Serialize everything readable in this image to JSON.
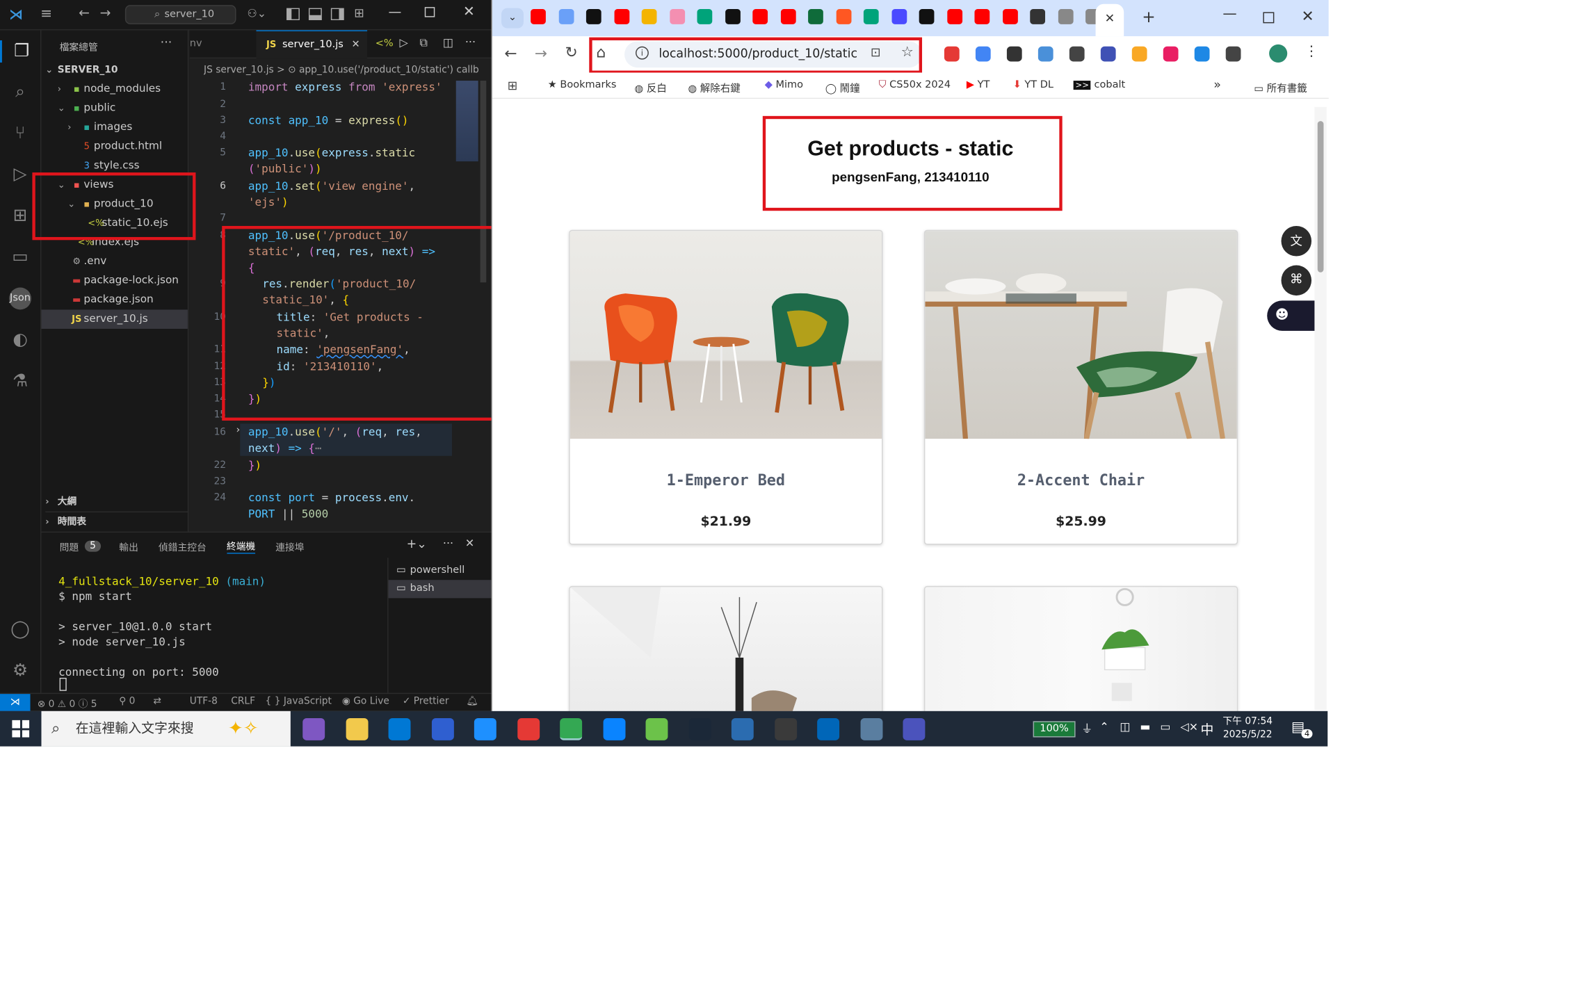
{
  "vscode": {
    "explorer_title": "檔案總管",
    "project": "SERVER_10",
    "search_label": "server_10",
    "tab_prev": "nv",
    "tab_active": "server_10.js",
    "breadcrumb": "JS server_10.js > ⊙ app_10.use('/product_10/static') callb",
    "tree": [
      "node_modules",
      "public",
      "images",
      "product.html",
      "style.css",
      "views",
      "product_10",
      "static_10.ejs",
      "index.ejs",
      ".env",
      "package-lock.json",
      "package.json",
      "server_10.js"
    ],
    "outline": "大綱",
    "timeline": "時間表",
    "line_numbers": [
      "1",
      "2",
      "3",
      "4",
      "5",
      "",
      "6",
      "",
      "7",
      "8",
      "",
      "9",
      "",
      "10",
      "",
      "11",
      "12",
      "13",
      "14",
      "15",
      "16",
      "",
      "22",
      "23",
      "24",
      ""
    ],
    "panel_tabs": [
      "問題",
      "輸出",
      "偵錯主控台",
      "終端機",
      "連接埠"
    ],
    "problems_count": "5",
    "terminal": {
      "path": "4_fullstack_10/server_10",
      "branch": "(main)",
      "cmd": "$ npm start",
      "out1": "> server_10@1.0.0 start",
      "out2": "> node server_10.js",
      "out3": "connecting on port: 5000"
    },
    "shells": [
      "powershell",
      "bash"
    ],
    "status": {
      "errors": "⊗ 0 ⚠ 0 ⓘ 5",
      "ports": "⚲ 0",
      "encoding": "UTF-8",
      "eol": "CRLF",
      "lang": "{ } JavaScript",
      "golive": "Go Live",
      "prettier": "✓ Prettier"
    }
  },
  "code": [
    {
      "t": "import express from 'express'"
    },
    {
      "t": "const app_10 = express()"
    },
    {
      "t": "app_10.use(express.static"
    },
    {
      "t": "('public'))"
    },
    {
      "t": "app_10.set('view engine',"
    },
    {
      "t": "'ejs')"
    },
    {
      "t": "app_10.use('/product_10/"
    },
    {
      "t": "static', (req, res, next) =>"
    },
    {
      "t": "{"
    },
    {
      "t": "res.render('product_10/"
    },
    {
      "t": "static_10', {"
    },
    {
      "t": "title: 'Get products -"
    },
    {
      "t": "static',"
    },
    {
      "t": "name: 'pengsenFang',"
    },
    {
      "t": "id: '213410110',"
    },
    {
      "t": "})"
    },
    {
      "t": "})"
    },
    {
      "t": "app_10.use('/', (req, res,"
    },
    {
      "t": "next) => {⋯"
    },
    {
      "t": "})"
    },
    {
      "t": "const port = process.env."
    },
    {
      "t": "PORT || 5000"
    }
  ],
  "chrome": {
    "url": "localhost:5000/product_10/static",
    "bookmarks": [
      "Bookmarks",
      "反白",
      "解除右鍵",
      "Mimo",
      "鬧鐘",
      "CS50x 2024",
      "YT",
      "YT DL",
      "cobalt"
    ],
    "all_bookmarks": "所有書籤",
    "more": "»"
  },
  "page": {
    "heading": "Get products - static",
    "subheading": "pengsenFang, 213410110",
    "products": [
      {
        "name": "1-Emperor Bed",
        "price": "$21.99"
      },
      {
        "name": "2-Accent Chair",
        "price": "$25.99"
      }
    ]
  },
  "taskbar": {
    "search_placeholder": "在這裡輸入文字來搜",
    "battery": "100%",
    "ime": "中",
    "time": "下午 07:54",
    "date": "2025/5/22",
    "notif": "4"
  }
}
